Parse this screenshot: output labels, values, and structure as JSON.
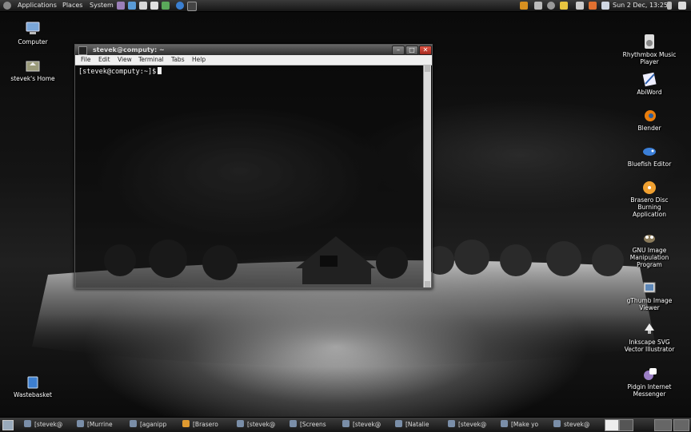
{
  "top_panel": {
    "menus": [
      "Applications",
      "Places",
      "System"
    ],
    "clock": "Sun 2 Dec, 13:25"
  },
  "desktop_left": [
    {
      "label": "Computer",
      "icon": "computer-icon"
    },
    {
      "label": "stevek's Home",
      "icon": "home-folder-icon"
    },
    {
      "label": "Wastebasket",
      "icon": "trash-icon"
    }
  ],
  "desktop_right": [
    {
      "label": "Rhythmbox Music Player",
      "icon": "rhythmbox-icon"
    },
    {
      "label": "AbiWord",
      "icon": "abiword-icon"
    },
    {
      "label": "Blender",
      "icon": "blender-icon"
    },
    {
      "label": "Bluefish Editor",
      "icon": "bluefish-icon"
    },
    {
      "label": "Brasero Disc Burning Application",
      "icon": "brasero-icon"
    },
    {
      "label": "GNU Image Manipulation Program",
      "icon": "gimp-icon"
    },
    {
      "label": "gThumb Image Viewer",
      "icon": "gthumb-icon"
    },
    {
      "label": "Inkscape SVG Vector Illustrator",
      "icon": "inkscape-icon"
    },
    {
      "label": "Pidgin Internet Messenger",
      "icon": "pidgin-icon"
    }
  ],
  "terminal": {
    "title": "stevek@computy: ~",
    "menu": [
      "File",
      "Edit",
      "View",
      "Terminal",
      "Tabs",
      "Help"
    ],
    "prompt": "[stevek@computy:~]$"
  },
  "taskbar": [
    "[stevek@",
    "[Murrine",
    "[aganipp",
    "[Brasero",
    "[stevek@",
    "[Screens",
    "[stevek@",
    "[Natalie",
    "[stevek@",
    "[Make yo",
    "stevek@"
  ],
  "colors": {
    "panel": "#1e1e1e",
    "close_button": "#c0392b",
    "terminal_menubar": "#efefef"
  }
}
